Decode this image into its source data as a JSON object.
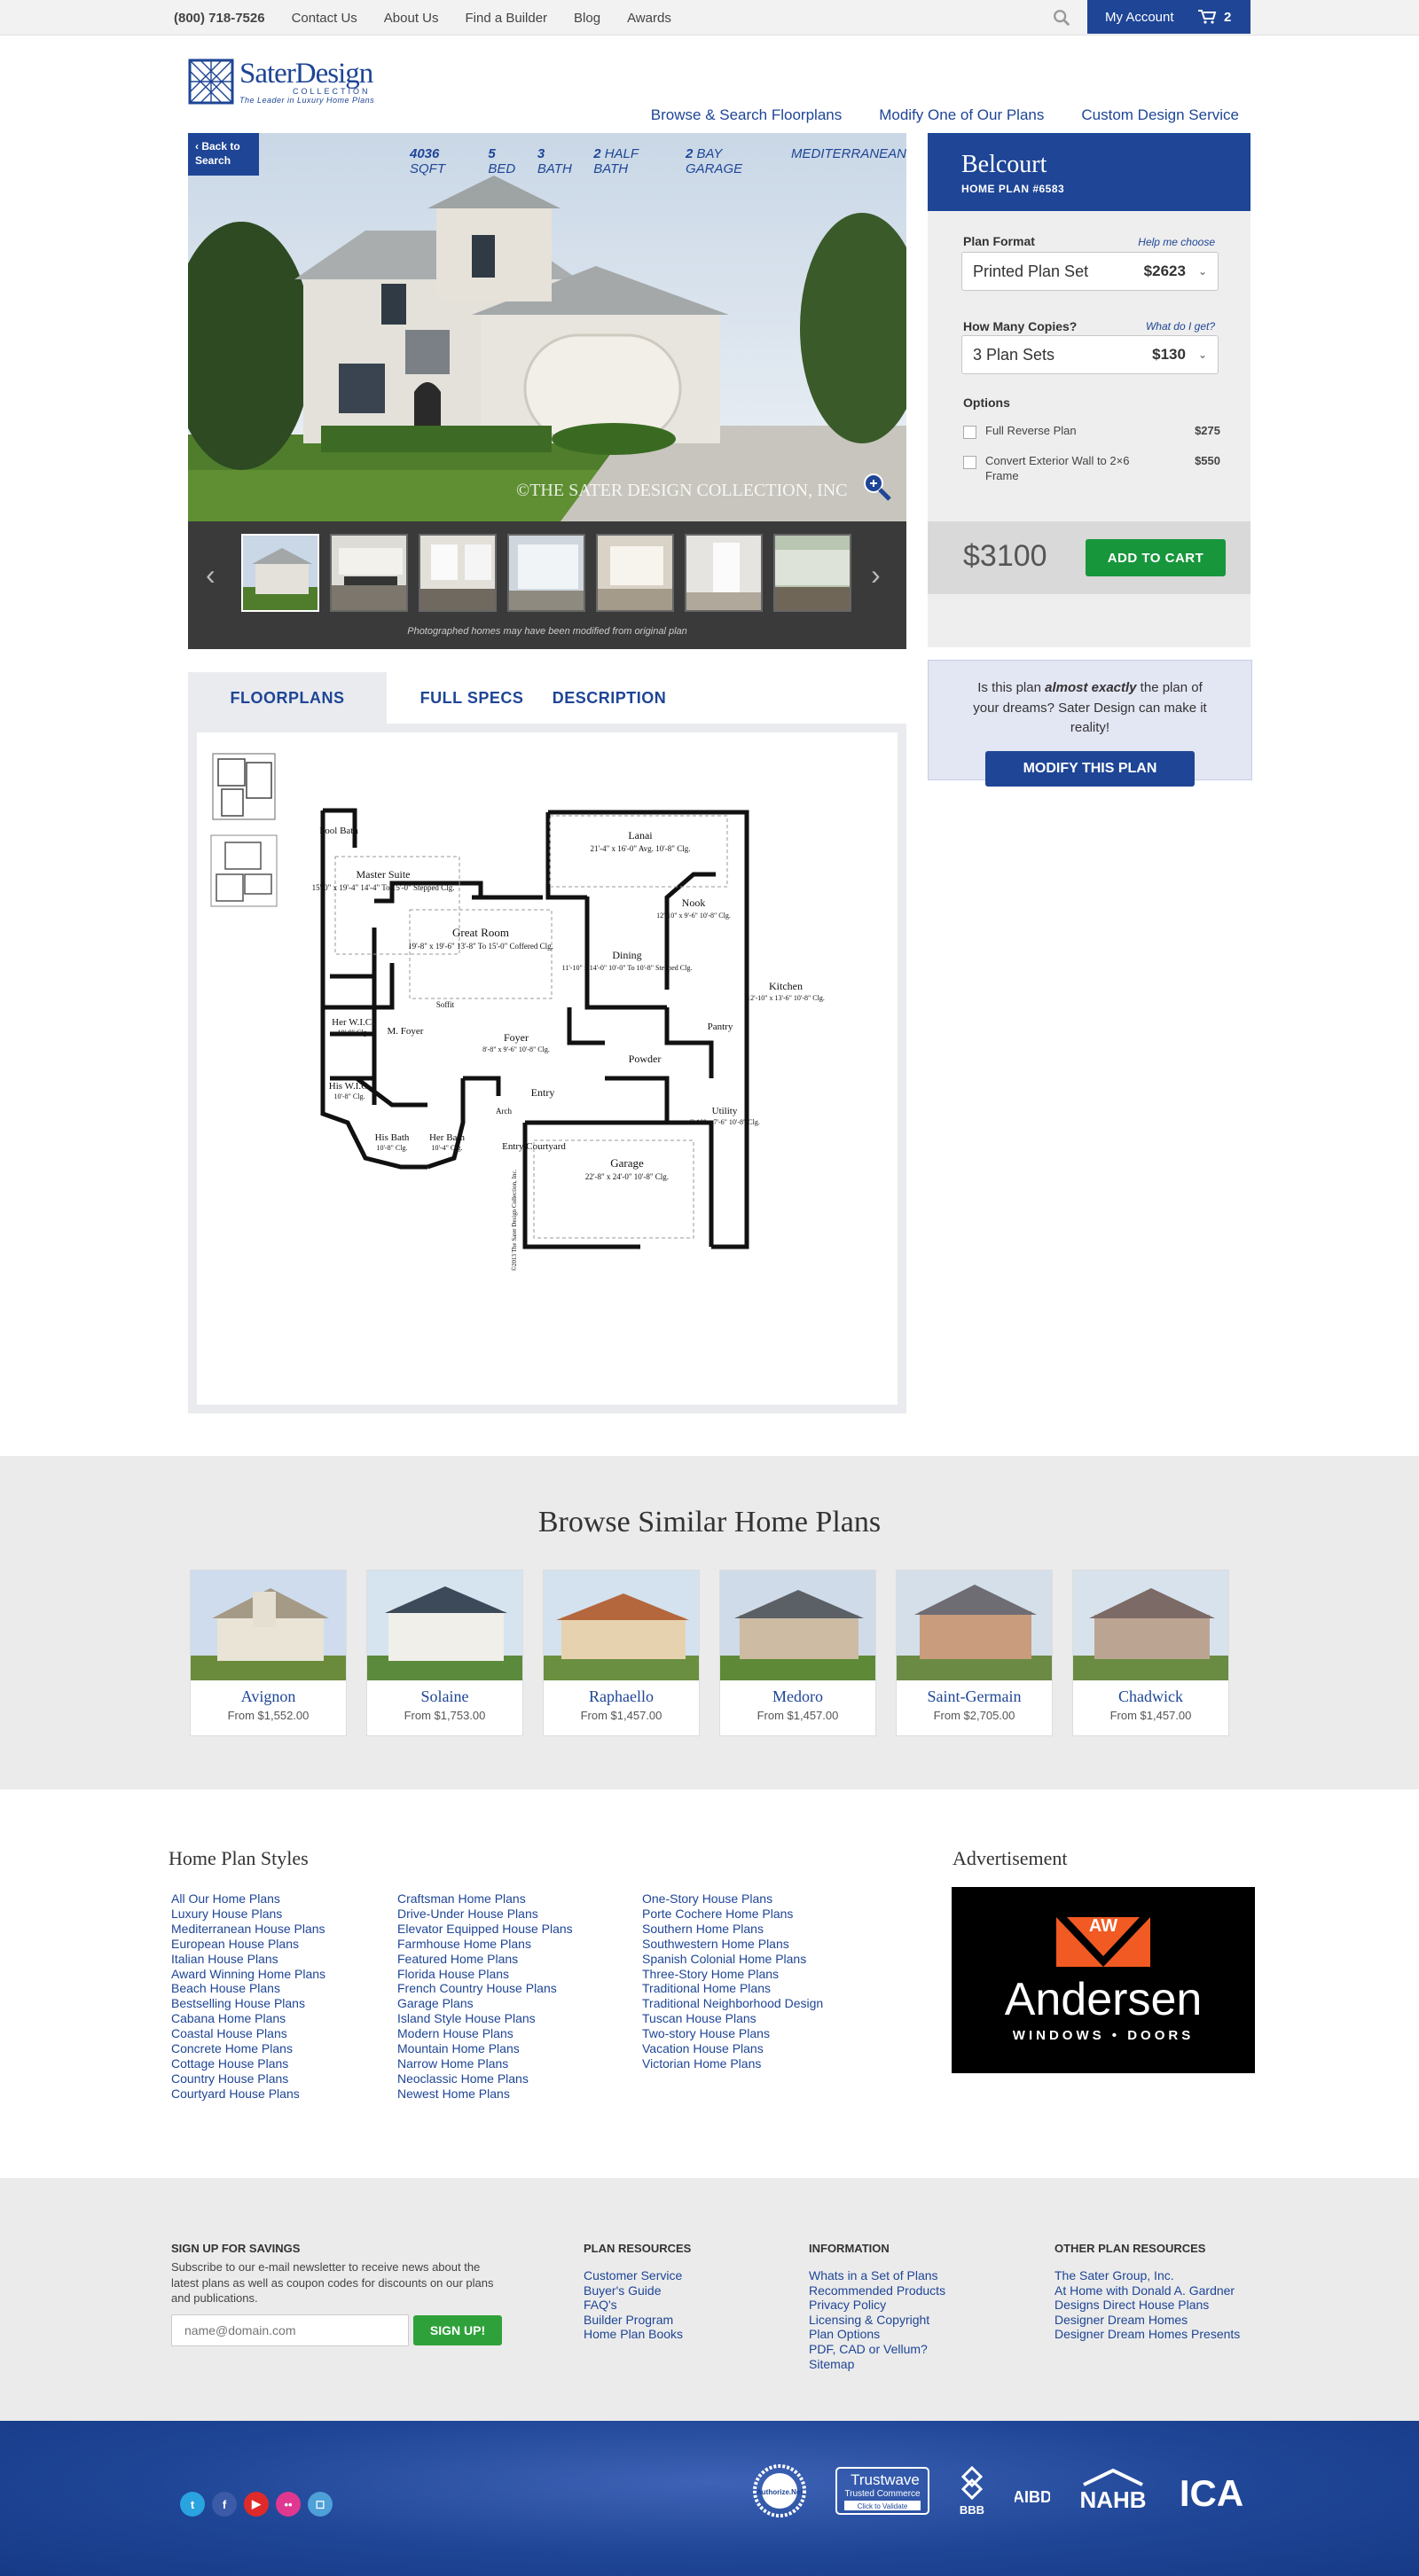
{
  "topbar": {
    "phone": "(800) 718-7526",
    "links": [
      "Contact Us",
      "About Us",
      "Find a Builder",
      "Blog",
      "Awards"
    ],
    "account_label": "My Account",
    "cart_count": "2"
  },
  "logo": {
    "name": "SaterDesign",
    "collection": "COLLECTION",
    "tagline": "The Leader in Luxury Home Plans"
  },
  "nav": [
    "Browse & Search Floorplans",
    "Modify One of Our Plans",
    "Custom Design Service"
  ],
  "gallery": {
    "back": "Back to Search",
    "specs": [
      {
        "v": "4036",
        "u": "SQFT"
      },
      {
        "v": "5",
        "u": "BED"
      },
      {
        "v": "3",
        "u": "BATH"
      },
      {
        "v": "2",
        "u": "HALF BATH"
      },
      {
        "v": "2",
        "u": "BAY GARAGE"
      },
      {
        "v": "",
        "u": "MEDITERRANEAN"
      }
    ],
    "watermark": "©THE SATER DESIGN COLLECTION, INC",
    "caption": "Photographed homes may have been modified from original plan"
  },
  "plan": {
    "name": "Belcourt",
    "number": "HOME PLAN #6583",
    "format_label": "Plan Format",
    "format_help": "Help me choose",
    "format_value": "Printed Plan Set",
    "format_price": "$2623",
    "copies_label": "How Many Copies?",
    "copies_help": "What do I get?",
    "copies_value": "3 Plan Sets",
    "copies_price": "$130",
    "options_label": "Options",
    "options": [
      {
        "label": "Full Reverse Plan",
        "price": "$275"
      },
      {
        "label": "Convert Exterior Wall to 2×6 Frame",
        "price": "$550"
      }
    ],
    "total": "$3100",
    "add_to_cart": "ADD TO CART"
  },
  "modify": {
    "text_pre": "Is this plan ",
    "text_em": "almost exactly",
    "text_post": " the plan of your dreams? Sater Design can make it reality!",
    "button": "MODIFY THIS PLAN"
  },
  "tabs": [
    "FLOORPLANS",
    "FULL SPECS",
    "DESCRIPTION"
  ],
  "floorplan": {
    "rooms": [
      "Pool Bath",
      "Master Suite",
      "Her W.I.C.",
      "His W.I.C.",
      "His Bath",
      "Her Bath",
      "Great Room",
      "Lanai",
      "Nook",
      "Dining",
      "Kitchen",
      "Foyer",
      "M. Foyer",
      "Entry",
      "Entry Courtyard",
      "Powder",
      "Pantry",
      "Utility",
      "Garage",
      "Soffit",
      "Arch"
    ],
    "notes": {
      "lanai": "21'-4\" x 16'-0\" Avg. 10'-8\" Clg.",
      "master": "15'-0\" x 19'-4\" 14'-4\" To 15'-0\" Stepped Clg.",
      "great": "19'-8\" x 19'-6\" 13'-8\" To 15'-0\" Coffered Clg.",
      "nook": "12'-10\" x 9'-6\" 10'-8\" Clg.",
      "dining": "11'-10\" x 14'-0\" 10'-0\" To 10'-8\" Stepped Clg.",
      "kitchen": "12'-10\" x 13'-6\" 10'-8\" Clg.",
      "foyer": "8'-8\" x 9'-6\" 10'-8\" Clg.",
      "garage": "22'-8\" x 24'-0\" 10'-8\" Clg.",
      "utility": "6'-10\" x 7'-6\" 10'-8\" Clg.",
      "herwic": "10'-8\" Clg.",
      "hiswic": "10'-8\" Clg.",
      "hisbath": "10'-8\" Clg.",
      "herbath": "10'-4\" Clg.",
      "copyright": "©2013 The Sater Design Collection, Inc."
    }
  },
  "similar": {
    "title": "Browse Similar Home Plans",
    "plans": [
      {
        "name": "Avignon",
        "price": "From $1,552.00"
      },
      {
        "name": "Solaine",
        "price": "From $1,753.00"
      },
      {
        "name": "Raphaello",
        "price": "From $1,457.00"
      },
      {
        "name": "Medoro",
        "price": "From $1,457.00"
      },
      {
        "name": "Saint-Germain",
        "price": "From $2,705.00"
      },
      {
        "name": "Chadwick",
        "price": "From $1,457.00"
      }
    ]
  },
  "styles": {
    "title": "Home Plan Styles",
    "col1": [
      "All Our Home Plans",
      "Luxury House Plans",
      "Mediterranean House Plans",
      "European House Plans",
      "Italian House Plans",
      "Award Winning Home Plans",
      "Beach House Plans",
      "Bestselling House Plans",
      "Cabana Home Plans",
      "Coastal House Plans",
      "Concrete Home Plans",
      "Cottage House Plans",
      "Country House Plans",
      "Courtyard House Plans"
    ],
    "col2": [
      "Craftsman Home Plans",
      "Drive-Under House Plans",
      "Elevator Equipped House Plans",
      "Farmhouse Home Plans",
      "Featured Home Plans",
      "Florida House Plans",
      "French Country House Plans",
      "Garage Plans",
      "Island Style House Plans",
      "Modern House Plans",
      "Mountain Home Plans",
      "Narrow Home Plans",
      "Neoclassic Home Plans",
      "Newest Home Plans"
    ],
    "col3": [
      "One-Story House Plans",
      "Porte Cochere Home Plans",
      "Southern Home Plans",
      "Southwestern Home Plans",
      "Spanish Colonial Home Plans",
      "Three-Story Home Plans",
      "Traditional Home Plans",
      "Traditional Neighborhood Design",
      "Tuscan House Plans",
      "Two-story House Plans",
      "Vacation House Plans",
      "Victorian Home Plans"
    ]
  },
  "ad": {
    "title": "Advertisement",
    "brand": "Andersen",
    "sub": "WINDOWS • DOORS",
    "aw": "AW"
  },
  "footer": {
    "signup_title": "SIGN UP FOR SAVINGS",
    "signup_text": "Subscribe to our e-mail newsletter to receive news about the latest plans as well as coupon codes for discounts on our plans and publications.",
    "signup_placeholder": "name@domain.com",
    "signup_button": "SIGN UP!",
    "resources_title": "PLAN RESOURCES",
    "resources": [
      "Customer Service",
      "Buyer's Guide",
      "FAQ's",
      "Builder Program",
      "Home Plan Books"
    ],
    "info_title": "INFORMATION",
    "info": [
      "Whats in a Set of Plans",
      "Recommended Products",
      "Privacy Policy",
      "Licensing & Copyright",
      "Plan Options",
      "PDF, CAD or Vellum?",
      "Sitemap"
    ],
    "other_title": "OTHER PLAN RESOURCES",
    "other": [
      "The Sater Group, Inc.",
      "At Home with Donald A. Gardner",
      "Designs Direct House Plans",
      "Designer Dream Homes",
      "Designer Dream Homes Presents"
    ]
  },
  "badges": {
    "authorize": "Authorize.Net",
    "trustwave": "Trustwave",
    "trustwave_sub": "Trusted Commerce",
    "trustwave_click": "Click to Validate",
    "bbb": "BBB",
    "aibd": "AIBD",
    "nahb": "NAHB",
    "ica": "ICA"
  },
  "social": [
    "twitter-icon",
    "facebook-icon",
    "youtube-icon",
    "flickr-icon",
    "instagram-icon"
  ],
  "colors": {
    "brand_blue": "#1e4596",
    "cart_green": "#18963c",
    "signup_green": "#2fa13b"
  }
}
